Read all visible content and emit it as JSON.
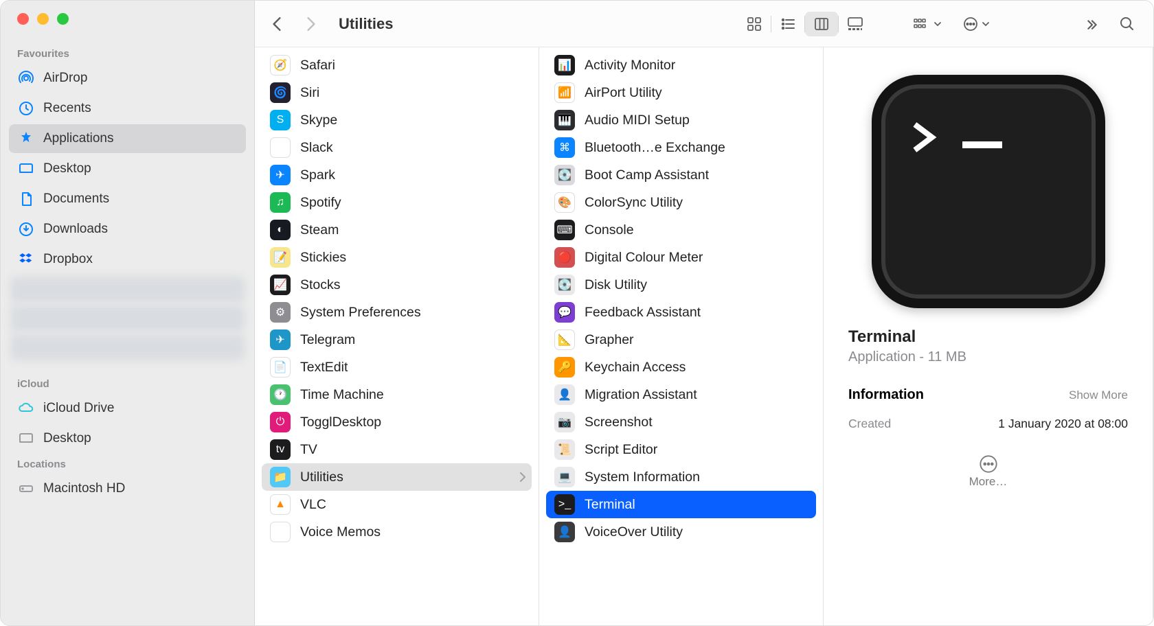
{
  "window_title": "Utilities",
  "traffic": {
    "red": "#ff5f57",
    "yellow": "#febc2e",
    "green": "#28c840"
  },
  "sidebar": {
    "sections": [
      {
        "label": "Favourites",
        "items": [
          {
            "icon": "airdrop",
            "label": "AirDrop",
            "color": "#0a84ff"
          },
          {
            "icon": "clock",
            "label": "Recents",
            "color": "#0a84ff"
          },
          {
            "icon": "apps",
            "label": "Applications",
            "color": "#0a84ff",
            "selected": true
          },
          {
            "icon": "desktop",
            "label": "Desktop",
            "color": "#0a84ff"
          },
          {
            "icon": "doc",
            "label": "Documents",
            "color": "#0a84ff"
          },
          {
            "icon": "download",
            "label": "Downloads",
            "color": "#0a84ff"
          },
          {
            "icon": "dropbox",
            "label": "Dropbox",
            "color": "#0061ff"
          }
        ],
        "blurred_count": 3
      },
      {
        "label": "iCloud",
        "items": [
          {
            "icon": "cloud",
            "label": "iCloud Drive",
            "color": "#2dc6dd"
          },
          {
            "icon": "desktop",
            "label": "Desktop",
            "color": "#9b9ba0"
          }
        ]
      },
      {
        "label": "Locations",
        "items": [
          {
            "icon": "hd",
            "label": "Macintosh HD",
            "color": "#9b9ba0"
          }
        ]
      }
    ]
  },
  "column1": [
    {
      "label": "Safari",
      "bg": "#ffffff",
      "fg": "#0a84ff",
      "glyph": "🧭"
    },
    {
      "label": "Siri",
      "bg": "#232131",
      "glyph": "🌀"
    },
    {
      "label": "Skype",
      "bg": "#00aff0",
      "glyph": "S"
    },
    {
      "label": "Slack",
      "bg": "#ffffff",
      "glyph": "✳"
    },
    {
      "label": "Spark",
      "bg": "#0a84ff",
      "glyph": "✈"
    },
    {
      "label": "Spotify",
      "bg": "#1db954",
      "glyph": "♫"
    },
    {
      "label": "Steam",
      "bg": "#171a21",
      "glyph": "◐"
    },
    {
      "label": "Stickies",
      "bg": "#f8e58c",
      "glyph": "📝"
    },
    {
      "label": "Stocks",
      "bg": "#1c1c1e",
      "glyph": "📈"
    },
    {
      "label": "System Preferences",
      "bg": "#8d8d92",
      "glyph": "⚙"
    },
    {
      "label": "Telegram",
      "bg": "#1e96c8",
      "glyph": "✈"
    },
    {
      "label": "TextEdit",
      "bg": "#ffffff",
      "glyph": "📄"
    },
    {
      "label": "Time Machine",
      "bg": "#4ac16d",
      "glyph": "🕐"
    },
    {
      "label": "TogglDesktop",
      "bg": "#e01b79",
      "glyph": "⏻"
    },
    {
      "label": "TV",
      "bg": "#1c1c1e",
      "glyph": "tv"
    },
    {
      "label": "Utilities",
      "bg": "#52c8f6",
      "glyph": "📁",
      "selected": true,
      "has_chevron": true
    },
    {
      "label": "VLC",
      "bg": "#ffffff",
      "glyph": "▲",
      "fg": "#ff8800"
    },
    {
      "label": "Voice Memos",
      "bg": "#ffffff",
      "glyph": "🎙"
    }
  ],
  "column2": [
    {
      "label": "Activity Monitor",
      "bg": "#1c1c1e",
      "glyph": "📊"
    },
    {
      "label": "AirPort Utility",
      "bg": "#ffffff",
      "glyph": "📶",
      "fg": "#0aa0ff"
    },
    {
      "label": "Audio MIDI Setup",
      "bg": "#2c2c2e",
      "glyph": "🎹"
    },
    {
      "label": "Bluetooth…e Exchange",
      "bg": "#0a84ff",
      "glyph": "⌘"
    },
    {
      "label": "Boot Camp Assistant",
      "bg": "#d9d9de",
      "glyph": "💽"
    },
    {
      "label": "ColorSync Utility",
      "bg": "#ffffff",
      "glyph": "🎨"
    },
    {
      "label": "Console",
      "bg": "#1c1c1e",
      "glyph": "⌨"
    },
    {
      "label": "Digital Colour Meter",
      "bg": "#d45050",
      "glyph": "🔴"
    },
    {
      "label": "Disk Utility",
      "bg": "#e9e9ec",
      "glyph": "💽"
    },
    {
      "label": "Feedback Assistant",
      "bg": "#7d3fd1",
      "glyph": "💬"
    },
    {
      "label": "Grapher",
      "bg": "#ffffff",
      "glyph": "📐"
    },
    {
      "label": "Keychain Access",
      "bg": "#ff9500",
      "glyph": "🔑"
    },
    {
      "label": "Migration Assistant",
      "bg": "#e9e9ec",
      "glyph": "👤"
    },
    {
      "label": "Screenshot",
      "bg": "#e9e9ec",
      "glyph": "📷"
    },
    {
      "label": "Script Editor",
      "bg": "#e9e9ec",
      "glyph": "📜"
    },
    {
      "label": "System Information",
      "bg": "#e9e9ec",
      "glyph": "💻"
    },
    {
      "label": "Terminal",
      "bg": "#1c1c1e",
      "glyph": ">_",
      "selected_blue": true
    },
    {
      "label": "VoiceOver Utility",
      "bg": "#3b3b3d",
      "glyph": "👤"
    }
  ],
  "preview": {
    "title": "Terminal",
    "subtitle": "Application - 11 MB",
    "info_header": "Information",
    "show_more": "Show More",
    "rows": [
      {
        "label": "Created",
        "value": "1 January 2020 at 08:00"
      }
    ],
    "more_label": "More…"
  }
}
